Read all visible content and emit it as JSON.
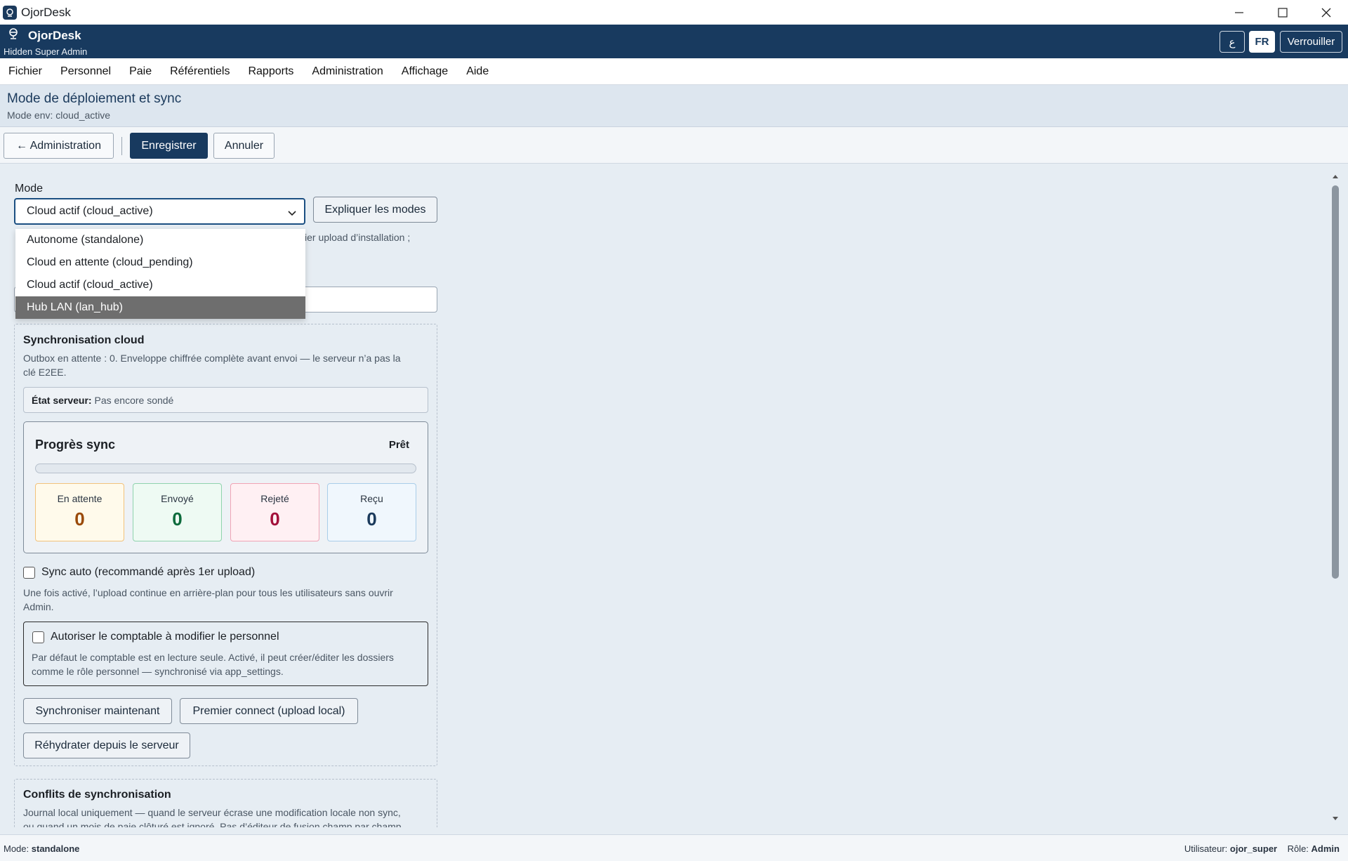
{
  "window": {
    "title": "OjorDesk"
  },
  "header": {
    "brand": "OjorDesk",
    "role_banner": "Hidden Super Admin",
    "rtl_button": "ع",
    "lang_button": "FR",
    "lock_button": "Verrouiller"
  },
  "menu": [
    "Fichier",
    "Personnel",
    "Paie",
    "Référentiels",
    "Rapports",
    "Administration",
    "Affichage",
    "Aide"
  ],
  "page": {
    "title": "Mode de déploiement et sync",
    "subtitle": "Mode env: cloud_active"
  },
  "toolbar": {
    "back": "← Administration",
    "save": "Enregistrer",
    "cancel": "Annuler"
  },
  "mode": {
    "label": "Mode",
    "selected": "Cloud actif (cloud_active)",
    "explain_button": "Expliquer les modes",
    "hint_fragment": "ier upload d’installation ;",
    "options": [
      "Autonome (standalone)",
      "Cloud en attente (cloud_pending)",
      "Cloud actif (cloud_active)",
      "Hub LAN (lan_hub)"
    ],
    "highlighted_option": "Hub LAN (lan_hub)"
  },
  "sync": {
    "title": "Synchronisation cloud",
    "desc_line1": "Outbox en attente : 0. Enveloppe chiffrée complète avant envoi — le serveur n’a pas la",
    "desc_line2": "clé E2EE.",
    "server_state_label": "État serveur:",
    "server_state_value": "Pas encore sondé",
    "progress": {
      "title": "Progrès sync",
      "status": "Prêt",
      "fraction": 0,
      "stats": [
        {
          "label": "En attente",
          "value": "0",
          "color": "#9a4a09"
        },
        {
          "label": "Envoyé",
          "value": "0",
          "color": "#0d6b3c"
        },
        {
          "label": "Rejeté",
          "value": "0",
          "color": "#a3103a"
        },
        {
          "label": "Reçu",
          "value": "0",
          "color": "#1b3a5c"
        }
      ]
    },
    "auto_label": "Sync auto (recommandé après 1er upload)",
    "auto_checked": false,
    "auto_hint1": "Une fois activé, l’upload continue en arrière-plan pour tous les utilisateurs sans ouvrir",
    "auto_hint2": "Admin.",
    "perm_label": "Autoriser le comptable à modifier le personnel",
    "perm_checked": false,
    "perm_hint1": "Par défaut le comptable est en lecture seule. Activé, il peut créer/éditer les dossiers",
    "perm_hint2": "comme le rôle personnel — synchronisé via app_settings.",
    "sync_now": "Synchroniser maintenant",
    "first_connect": "Premier connect (upload local)",
    "rehydrate": "Réhydrater depuis le serveur"
  },
  "conflicts": {
    "title": "Conflits de synchronisation",
    "desc_line1": "Journal local uniquement — quand le serveur écrase une modification locale non sync,",
    "desc_line2": "ou quand un mois de paie clôturé est ignoré. Pas d’éditeur de fusion champ par champ."
  },
  "statusbar": {
    "mode_label": "Mode:",
    "mode_value": "standalone",
    "user_label": "Utilisateur:",
    "user_value": "ojor_super",
    "role_label": "Rôle:",
    "role_value": "Admin"
  }
}
